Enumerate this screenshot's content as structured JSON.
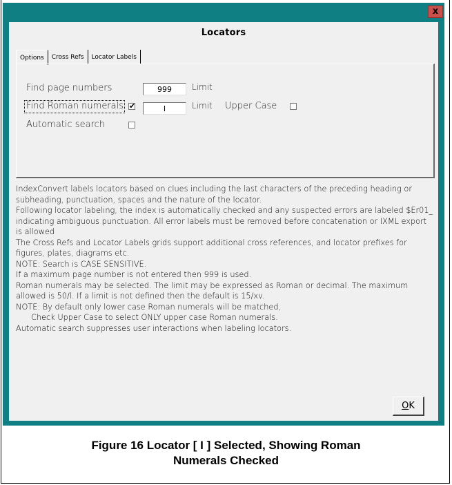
{
  "dialog": {
    "title": "Locators",
    "close_label": "x",
    "tabs": [
      {
        "label": "Options",
        "active": true
      },
      {
        "label": "Cross Refs",
        "active": false
      },
      {
        "label": "Locator Labels",
        "active": false
      }
    ]
  },
  "options": {
    "find_page_numbers_label": "Find page numbers",
    "page_limit_value": "999",
    "page_limit_label": "Limit",
    "find_roman_label": "Find Roman numerals",
    "find_roman_checked": true,
    "roman_limit_value": "I",
    "roman_limit_label": "Limit",
    "upper_case_label": "Upper Case",
    "upper_case_checked": false,
    "automatic_search_label": "Automatic search",
    "automatic_search_checked": false
  },
  "help_lines": [
    "IndexConvert labels locators based on clues including the last characters of the preceding heading or subheading, punctuation, spaces and the nature of the locator.",
    "Following locator labeling, the index is automatically checked and any suspected errors are labeled $Er01_ indicating ambiguous punctuation. All error labels must be removed before concatenation or IXML export is allowed",
    "The Cross Refs and Locator Labels grids support additional cross references, and locator prefixes for figures, plates, diagrams etc.",
    "NOTE: Search is CASE SENSITIVE.",
    "If a maximum page number is not entered then 999 is used.",
    "Roman numerals may be selected. The limit may be expressed as Roman or decimal. The maximum allowed is 50/l. If a limit is not defined then the default is 15/xv.",
    "NOTE: By default only lower case Roman numerals will be matched,",
    "Check Upper Case to select ONLY upper case Roman numerals.",
    "Automatic search suppresses user interactions when labeling locators."
  ],
  "buttons": {
    "ok_prefix": "O",
    "ok_rest": "K"
  },
  "caption": {
    "line1": "Figure 16 Locator [ I ] Selected, Showing Roman",
    "line2": "Numerals Checked"
  },
  "colors": {
    "titlebar": "#0f7f84",
    "close": "#c7504d",
    "client": "#f0f0f0"
  }
}
